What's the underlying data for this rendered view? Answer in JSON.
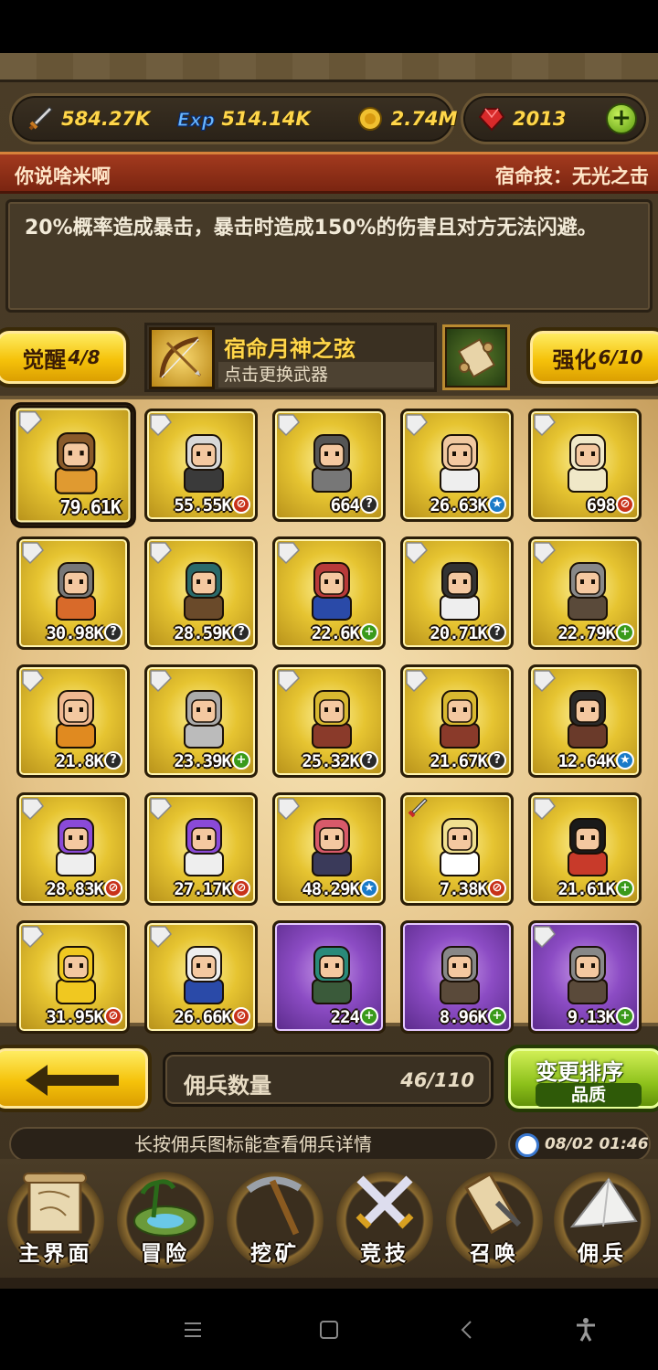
{
  "resources": {
    "attack": "584.27K",
    "exp": "514.14K",
    "gold": "2.74M",
    "gems": "2013"
  },
  "colors": {
    "gold_text": "#ffd64a",
    "header_red": "#a33a1e",
    "card_gold": "#e6c431",
    "card_purple": "#8c4cc4",
    "badge_plus": "#3a9a1a",
    "badge_no": "#c8321a",
    "badge_star": "#1a7ac8"
  },
  "skill": {
    "hero_name": "你说啥米啊",
    "fate_skill": "宿命技：无光之击",
    "description": "20%概率造成暴击，暴击时造成150%的伤害且对方无法闪避。"
  },
  "awaken": {
    "label": "觉醒",
    "value": "4/8"
  },
  "enhance": {
    "label": "强化",
    "value": "6/10"
  },
  "weapon": {
    "name": "宿命月神之弦",
    "hint": "点击更换武器",
    "icon": "bow-icon"
  },
  "mercenaries": [
    {
      "power": "79.61K",
      "badge": "none",
      "frame": "gold",
      "selected": true,
      "sprite": "hero-brown-hair",
      "tag": "card-tag"
    },
    {
      "power": "55.55K",
      "badge": "no",
      "frame": "gold",
      "sprite": "hero-white-beard",
      "tag": "card-tag"
    },
    {
      "power": "664",
      "badge": "q",
      "frame": "gold",
      "sprite": "hero-armored",
      "tag": "card-tag"
    },
    {
      "power": "26.63K",
      "badge": "star",
      "frame": "gold",
      "sprite": "hero-bald-suit",
      "tag": "card-tag"
    },
    {
      "power": "698",
      "badge": "no",
      "frame": "gold",
      "sprite": "hero-ghost",
      "tag": "card-tag"
    },
    {
      "power": "30.98K",
      "badge": "q",
      "frame": "gold",
      "sprite": "hero-grey-beard",
      "tag": "card-tag"
    },
    {
      "power": "28.59K",
      "badge": "q",
      "frame": "gold",
      "sprite": "hero-eagle",
      "tag": "card-tag"
    },
    {
      "power": "22.6K",
      "badge": "plus",
      "frame": "gold",
      "sprite": "hero-red-hair",
      "tag": "card-tag"
    },
    {
      "power": "20.71K",
      "badge": "q",
      "frame": "gold",
      "sprite": "hero-eyepatch",
      "tag": "card-tag"
    },
    {
      "power": "22.79K",
      "badge": "plus",
      "frame": "gold",
      "sprite": "hero-rider",
      "tag": "card-tag"
    },
    {
      "power": "21.8K",
      "badge": "q",
      "frame": "gold",
      "sprite": "hero-monk",
      "tag": "card-tag"
    },
    {
      "power": "23.39K",
      "badge": "plus",
      "frame": "gold",
      "sprite": "hero-gargoyle",
      "tag": "card-tag"
    },
    {
      "power": "25.32K",
      "badge": "q",
      "frame": "gold",
      "sprite": "hero-viking",
      "tag": "card-tag"
    },
    {
      "power": "21.67K",
      "badge": "q",
      "frame": "gold",
      "sprite": "hero-viking",
      "tag": "card-tag"
    },
    {
      "power": "12.64K",
      "badge": "star",
      "frame": "gold",
      "sprite": "hero-barbarian",
      "tag": "card-tag"
    },
    {
      "power": "28.83K",
      "badge": "no",
      "frame": "gold",
      "sprite": "hero-purple-hair",
      "tag": "card-tag"
    },
    {
      "power": "27.17K",
      "badge": "no",
      "frame": "gold",
      "sprite": "hero-purple-hair",
      "tag": "card-tag"
    },
    {
      "power": "48.29K",
      "badge": "star",
      "frame": "gold",
      "sprite": "hero-pink-hair",
      "tag": "card-tag"
    },
    {
      "power": "7.38K",
      "badge": "no",
      "frame": "gold",
      "sprite": "hero-blonde",
      "tag": "sword-tag"
    },
    {
      "power": "21.61K",
      "badge": "plus",
      "frame": "gold",
      "sprite": "hero-black-hair",
      "tag": "card-tag"
    },
    {
      "power": "31.95K",
      "badge": "no",
      "frame": "gold",
      "sprite": "hero-star",
      "tag": "card-tag"
    },
    {
      "power": "26.66K",
      "badge": "no",
      "frame": "gold",
      "sprite": "hero-old-chef",
      "tag": "card-tag"
    },
    {
      "power": "224",
      "badge": "plus",
      "frame": "purple",
      "sprite": "hero-green-hair",
      "tag": "none"
    },
    {
      "power": "8.96K",
      "badge": "plus",
      "frame": "purple",
      "sprite": "hero-rider",
      "tag": "none"
    },
    {
      "power": "9.13K",
      "badge": "plus",
      "frame": "purple",
      "sprite": "hero-rider",
      "tag": "card-tag"
    }
  ],
  "count": {
    "label": "佣兵数量",
    "value": "46/110"
  },
  "sort": {
    "title": "变更排序",
    "sub": "品质"
  },
  "hint": "长按佣兵图标能查看佣兵详情",
  "time": "08/02 01:46",
  "nav": [
    {
      "label": "主界面",
      "icon": "map-scroll-icon"
    },
    {
      "label": "冒险",
      "icon": "island-icon"
    },
    {
      "label": "挖矿",
      "icon": "pickaxe-icon"
    },
    {
      "label": "竞技",
      "icon": "crossed-swords-icon"
    },
    {
      "label": "召唤",
      "icon": "summon-scroll-icon"
    },
    {
      "label": "佣兵",
      "icon": "tent-icon"
    }
  ]
}
